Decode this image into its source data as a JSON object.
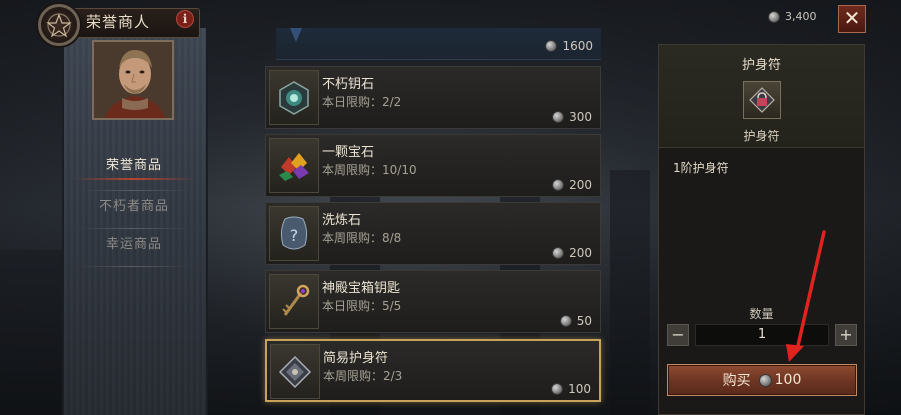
{
  "header": {
    "title": "荣誉商人",
    "info_icon": "info-icon",
    "emblem_icon": "pentagram-emblem-icon"
  },
  "currency": {
    "icon": "silver-coin-icon",
    "amount": "3,400"
  },
  "close": {
    "icon": "close-icon",
    "label": "✕"
  },
  "sidebar": {
    "items": [
      {
        "label": "荣誉商品",
        "active": true
      },
      {
        "label": "不朽者商品",
        "active": false
      },
      {
        "label": "幸运商品",
        "active": false
      }
    ]
  },
  "shop": {
    "top_partial_price": "1600",
    "items": [
      {
        "name": "不朽钥石",
        "limit": "本日限购：2/2",
        "price": "300",
        "icon": "immortal-keystone-icon"
      },
      {
        "name": "一颗宝石",
        "limit": "本周限购：10/10",
        "price": "200",
        "icon": "gem-icon"
      },
      {
        "name": "洗炼石",
        "limit": "本周限购：8/8",
        "price": "200",
        "icon": "reforge-stone-icon"
      },
      {
        "name": "神殿宝箱钥匙",
        "limit": "本日限购：5/5",
        "price": "50",
        "icon": "temple-chest-key-icon"
      },
      {
        "name": "简易护身符",
        "limit": "本周限购：2/3",
        "price": "100",
        "icon": "simple-charm-icon",
        "selected": true
      }
    ]
  },
  "detail": {
    "title": "护身符",
    "icon_label": "护身符",
    "icon": "charm-icon",
    "description": "1阶护身符",
    "quantity_label": "数量",
    "quantity_value": "1",
    "minus": "−",
    "plus": "+",
    "buy_label": "购买",
    "buy_price": "100"
  },
  "colors": {
    "accent_gold": "#c9a25a",
    "buy_button": "#6c3422",
    "annotation_arrow": "#e0231f"
  }
}
